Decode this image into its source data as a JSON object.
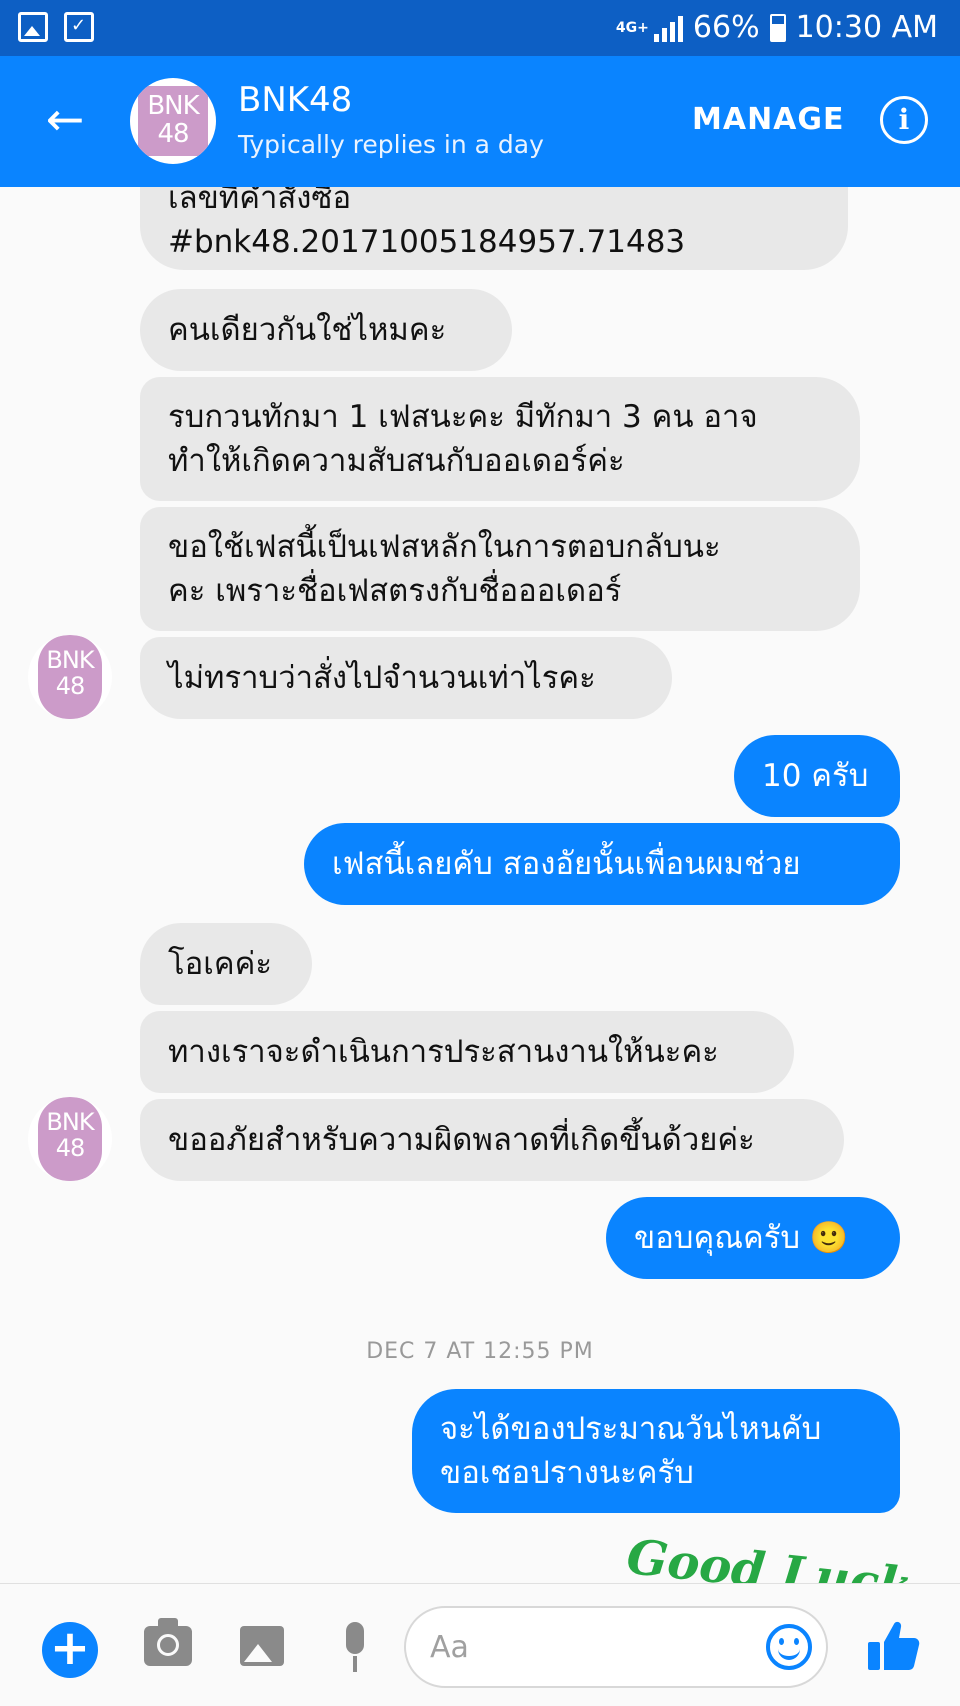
{
  "status_bar": {
    "network": "4G+",
    "battery": "66%",
    "time": "10:30 AM",
    "icons": [
      "gallery-icon",
      "task-check-icon",
      "signal-icon",
      "battery-charging-icon"
    ]
  },
  "header": {
    "back_icon": "back-arrow-icon",
    "avatar_text": "BNK48",
    "title": "BNK48",
    "subtitle": "Typically replies in a day",
    "manage_label": "MANAGE",
    "info_icon": "info-icon",
    "color": "#0a84ff"
  },
  "messages": [
    {
      "side": "in",
      "lines": [
        "เลขที่คำสั่งซื้อ",
        "#bnk48.20171005184957.71483"
      ]
    },
    {
      "side": "in",
      "lines": [
        "คนเดียวกันใช่ไหมคะ"
      ]
    },
    {
      "side": "in",
      "lines": [
        "รบกวนทักมา 1 เฟสนะคะ มีทักมา 3 คน อาจ",
        "ทำให้เกิดความสับสนกับออเดอร์ค่ะ"
      ]
    },
    {
      "side": "in",
      "lines": [
        "ขอใช้เฟสนี้เป็นเฟสหลักในการตอบกลับนะ",
        "คะ เพราะชื่อเฟสตรงกับชื่อออเดอร์"
      ]
    },
    {
      "side": "in",
      "lines": [
        "ไม่ทราบว่าสั่งไปจำนวนเท่าไรคะ"
      ]
    },
    {
      "side": "out",
      "lines": [
        "10 ครับ"
      ]
    },
    {
      "side": "out",
      "lines": [
        "เฟสนี้เลยคับ สองอัยนั้นเพื่อนผมช่วย"
      ]
    },
    {
      "side": "in",
      "lines": [
        "โอเคค่ะ"
      ]
    },
    {
      "side": "in",
      "lines": [
        "ทางเราจะดำเนินการประสานงานให้นะคะ"
      ]
    },
    {
      "side": "in",
      "lines": [
        "ขออภัยสำหรับความผิดพลาดที่เกิดขึ้นด้วยค่ะ"
      ]
    },
    {
      "side": "out",
      "lines": [
        "ขอบคุณครับ 🙂"
      ]
    },
    {
      "side": "out",
      "lines": [
        "จะได้ของประมาณวันไหนคับ",
        "ขอเชอปรางนะครับ"
      ]
    }
  ],
  "avatar_text": "BNK48",
  "timestamp": "DEC 7 AT 12:55 PM",
  "sticker_text": "Good Luck",
  "composer": {
    "placeholder": "Aa",
    "icons": [
      "plus-icon",
      "camera-icon",
      "image-icon",
      "microphone-icon",
      "emoji-icon",
      "thumbs-up-icon"
    ]
  },
  "colors": {
    "outgoing_bubble": "#0a84ff",
    "incoming_bubble": "#e8e8e8",
    "status_bar": "#0d5fc4"
  }
}
